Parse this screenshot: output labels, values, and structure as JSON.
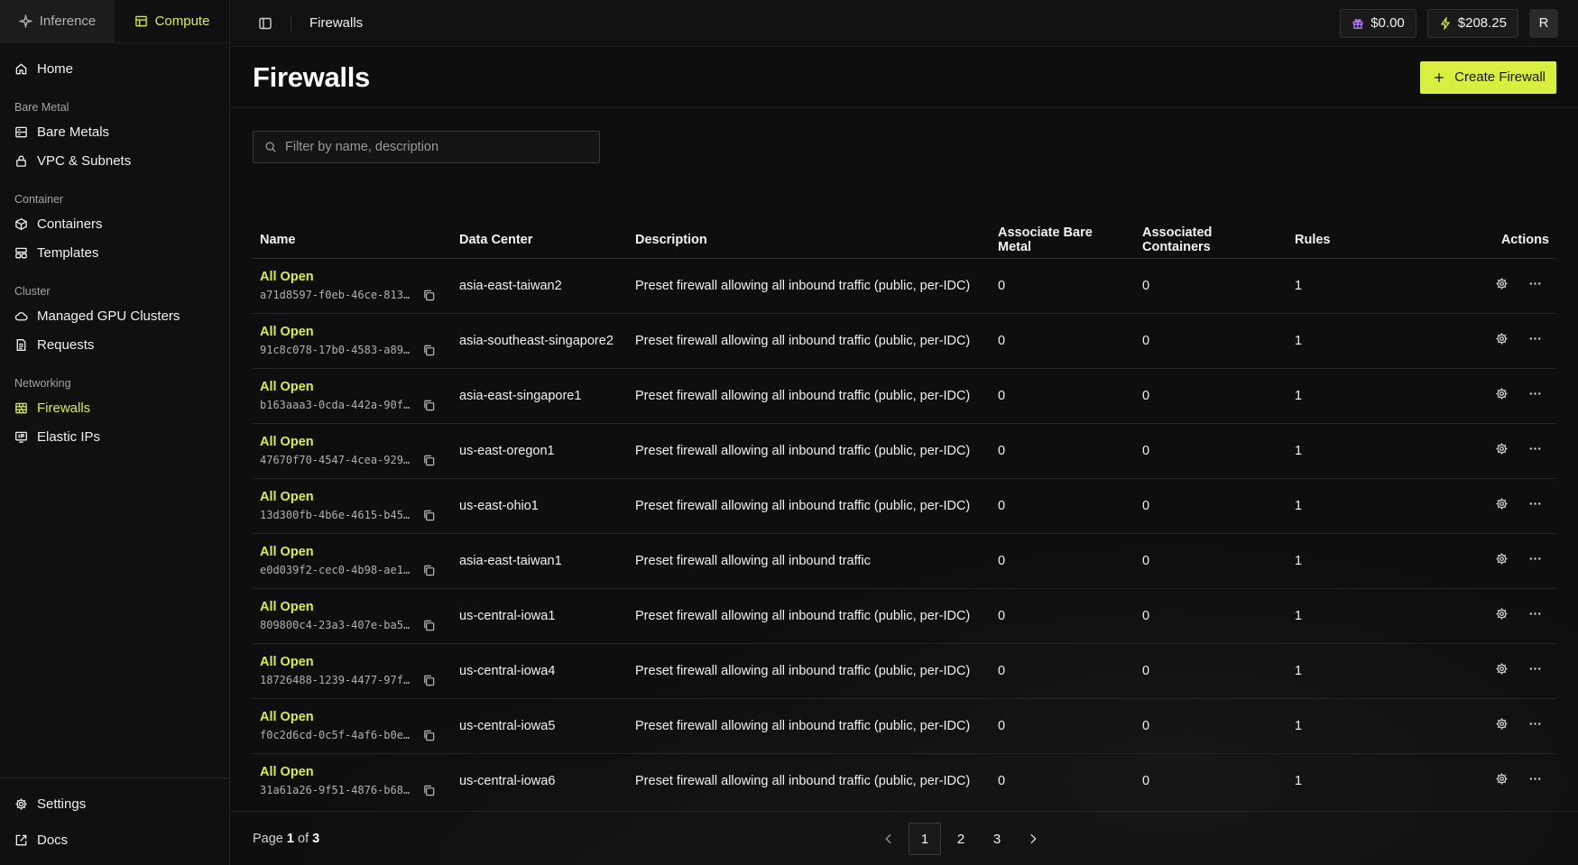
{
  "mode_switch": {
    "inference": "Inference",
    "compute": "Compute"
  },
  "sidebar": {
    "home": "Home",
    "sections": [
      {
        "title": "Bare Metal",
        "items": [
          "Bare Metals",
          "VPC & Subnets"
        ]
      },
      {
        "title": "Container",
        "items": [
          "Containers",
          "Templates"
        ]
      },
      {
        "title": "Cluster",
        "items": [
          "Managed GPU Clusters",
          "Requests"
        ]
      },
      {
        "title": "Networking",
        "items": [
          "Firewalls",
          "Elastic IPs"
        ]
      }
    ],
    "settings": "Settings",
    "docs": "Docs"
  },
  "topbar": {
    "breadcrumb": "Firewalls",
    "credits": "$0.00",
    "balance": "$208.25",
    "avatar_initial": "R"
  },
  "page": {
    "title": "Firewalls",
    "create_label": "Create Firewall",
    "filter_placeholder": "Filter by name, description"
  },
  "table": {
    "headers": {
      "name": "Name",
      "data_center": "Data Center",
      "description": "Description",
      "bare_metal": "Associate Bare Metal",
      "containers": "Associated Containers",
      "rules": "Rules",
      "actions": "Actions"
    },
    "rows": [
      {
        "name": "All Open",
        "id": "a71d8597-f0eb-46ce-813c…",
        "dc": "asia-east-taiwan2",
        "desc": "Preset firewall allowing all inbound traffic (public, per-IDC)",
        "bm": "0",
        "ct": "0",
        "rules": "1"
      },
      {
        "name": "All Open",
        "id": "91c8c078-17b0-4583-a899…",
        "dc": "asia-southeast-singapore2",
        "desc": "Preset firewall allowing all inbound traffic (public, per-IDC)",
        "bm": "0",
        "ct": "0",
        "rules": "1"
      },
      {
        "name": "All Open",
        "id": "b163aaa3-0cda-442a-90fa…",
        "dc": "asia-east-singapore1",
        "desc": "Preset firewall allowing all inbound traffic (public, per-IDC)",
        "bm": "0",
        "ct": "0",
        "rules": "1"
      },
      {
        "name": "All Open",
        "id": "47670f70-4547-4cea-9291…",
        "dc": "us-east-oregon1",
        "desc": "Preset firewall allowing all inbound traffic (public, per-IDC)",
        "bm": "0",
        "ct": "0",
        "rules": "1"
      },
      {
        "name": "All Open",
        "id": "13d300fb-4b6e-4615-b451…",
        "dc": "us-east-ohio1",
        "desc": "Preset firewall allowing all inbound traffic (public, per-IDC)",
        "bm": "0",
        "ct": "0",
        "rules": "1"
      },
      {
        "name": "All Open",
        "id": "e0d039f2-cec0-4b98-ae1b…",
        "dc": "asia-east-taiwan1",
        "desc": "Preset firewall allowing all inbound traffic",
        "bm": "0",
        "ct": "0",
        "rules": "1"
      },
      {
        "name": "All Open",
        "id": "809800c4-23a3-407e-ba57…",
        "dc": "us-central-iowa1",
        "desc": "Preset firewall allowing all inbound traffic (public, per-IDC)",
        "bm": "0",
        "ct": "0",
        "rules": "1"
      },
      {
        "name": "All Open",
        "id": "18726488-1239-4477-97f9…",
        "dc": "us-central-iowa4",
        "desc": "Preset firewall allowing all inbound traffic (public, per-IDC)",
        "bm": "0",
        "ct": "0",
        "rules": "1"
      },
      {
        "name": "All Open",
        "id": "f0c2d6cd-0c5f-4af6-b0e9…",
        "dc": "us-central-iowa5",
        "desc": "Preset firewall allowing all inbound traffic (public, per-IDC)",
        "bm": "0",
        "ct": "0",
        "rules": "1"
      },
      {
        "name": "All Open",
        "id": "31a61a26-9f51-4876-b682…",
        "dc": "us-central-iowa6",
        "desc": "Preset firewall allowing all inbound traffic (public, per-IDC)",
        "bm": "0",
        "ct": "0",
        "rules": "1"
      }
    ]
  },
  "pagination": {
    "page_label": "Page",
    "of_label": "of",
    "current": "1",
    "total": "3",
    "pages": [
      "1",
      "2",
      "3"
    ]
  },
  "colors": {
    "accent": "#d9ef3f",
    "background": "#0e0e0e",
    "sidebar": "#101010"
  },
  "icons": {
    "inference": "sparkle-icon",
    "compute": "server-icon",
    "home": "home-icon",
    "bare_metals": "server-rack-icon",
    "vpc": "lock-icon",
    "containers": "cube-icon",
    "templates": "layout-icon",
    "clusters": "cloud-icon",
    "requests": "document-icon",
    "firewalls": "brick-wall-icon",
    "elastic_ips": "ip-icon",
    "settings": "gear-icon",
    "docs": "external-link-icon",
    "credits": "gift-icon",
    "balance": "bolt-icon"
  }
}
